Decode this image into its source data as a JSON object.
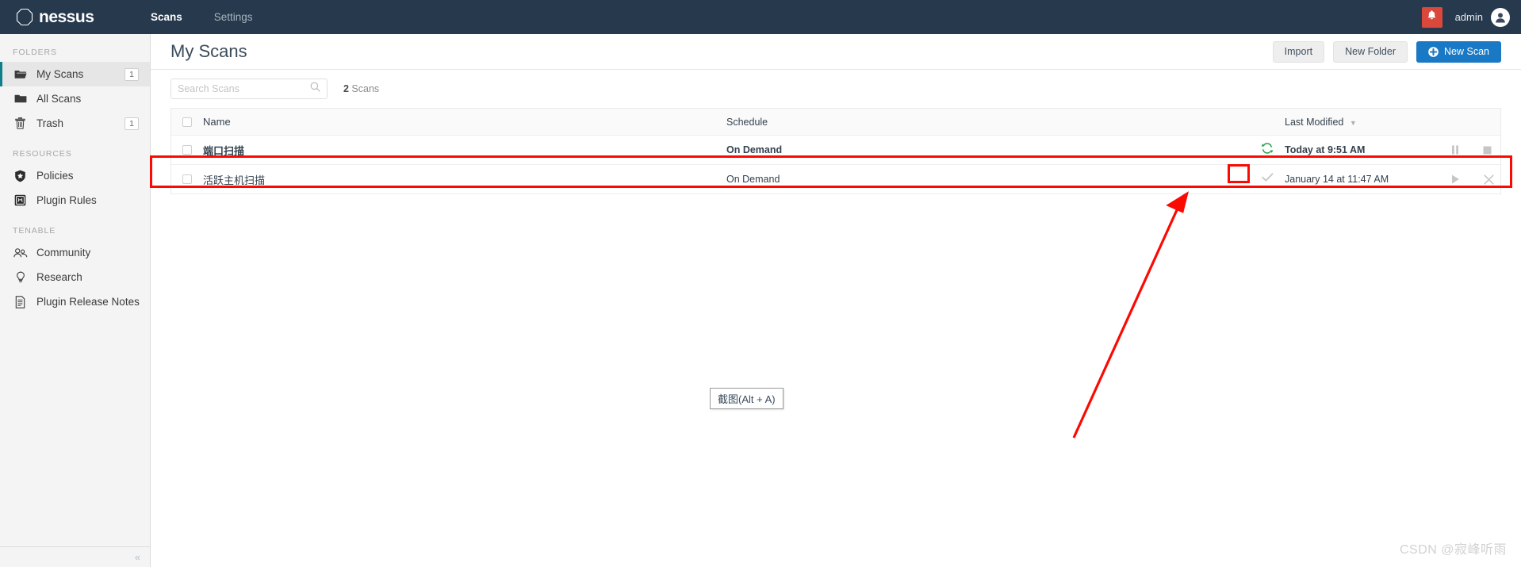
{
  "topbar": {
    "brand": "nessus",
    "logo_icon": "octagon-outline-icon",
    "nav": [
      {
        "label": "Scans",
        "active": true
      },
      {
        "label": "Settings",
        "active": false
      }
    ],
    "notifications_icon": "bell-icon",
    "notifications_color": "#d9483b",
    "user_name": "admin",
    "avatar_icon": "user-avatar-icon",
    "background_color": "#26394d"
  },
  "sidebar": {
    "sections": [
      {
        "heading": "FOLDERS",
        "items": [
          {
            "label": "My Scans",
            "icon": "folder-open-icon",
            "badge": "1",
            "active": true
          },
          {
            "label": "All Scans",
            "icon": "folder-icon",
            "badge": "",
            "active": false
          },
          {
            "label": "Trash",
            "icon": "trash-icon",
            "badge": "1",
            "active": false
          }
        ]
      },
      {
        "heading": "RESOURCES",
        "items": [
          {
            "label": "Policies",
            "icon": "shield-badge-icon",
            "badge": "",
            "active": false
          },
          {
            "label": "Plugin Rules",
            "icon": "plugin-square-icon",
            "badge": "",
            "active": false
          }
        ]
      },
      {
        "heading": "TENABLE",
        "items": [
          {
            "label": "Community",
            "icon": "people-icon",
            "badge": "",
            "active": false
          },
          {
            "label": "Research",
            "icon": "lightbulb-icon",
            "badge": "",
            "active": false
          },
          {
            "label": "Plugin Release Notes",
            "icon": "document-icon",
            "badge": "",
            "active": false
          }
        ]
      }
    ],
    "collapse_icon": "chevron-double-left-icon",
    "active_accent_color": "#0d7e8c"
  },
  "main": {
    "page_title": "My Scans",
    "buttons": {
      "import": "Import",
      "new_folder": "New Folder",
      "new_scan": "New Scan",
      "new_scan_icon": "plus-circle-icon",
      "primary_color": "#1a79c4"
    },
    "search": {
      "placeholder": "Search Scans",
      "value": "",
      "icon": "search-icon"
    },
    "scan_count_number": "2",
    "scan_count_label": " Scans",
    "table": {
      "columns": {
        "name": "Name",
        "schedule": "Schedule",
        "last_modified": "Last Modified",
        "sort_icon": "caret-down-icon"
      },
      "rows": [
        {
          "name": "端口扫描",
          "schedule": "On Demand",
          "status_icon": "running-refresh-icon",
          "status_color": "#22a34a",
          "last_modified": "Today at 9:51 AM",
          "actions": [
            {
              "icon": "pause-icon",
              "name": "pause-scan-button"
            },
            {
              "icon": "stop-icon",
              "name": "stop-scan-button"
            }
          ],
          "highlighted": true,
          "running": true
        },
        {
          "name": "活跃主机扫描",
          "schedule": "On Demand",
          "status_icon": "check-icon",
          "status_color": "#c6c6c6",
          "last_modified": "January 14 at 11:47 AM",
          "actions": [
            {
              "icon": "play-icon",
              "name": "launch-scan-button"
            },
            {
              "icon": "close-icon",
              "name": "delete-scan-button"
            }
          ],
          "highlighted": false,
          "running": false
        }
      ]
    }
  },
  "annotations": {
    "highlight_color": "#fb0a02",
    "tooltip_text": "截图(Alt + A)",
    "watermark": "CSDN @寂峰听雨"
  }
}
